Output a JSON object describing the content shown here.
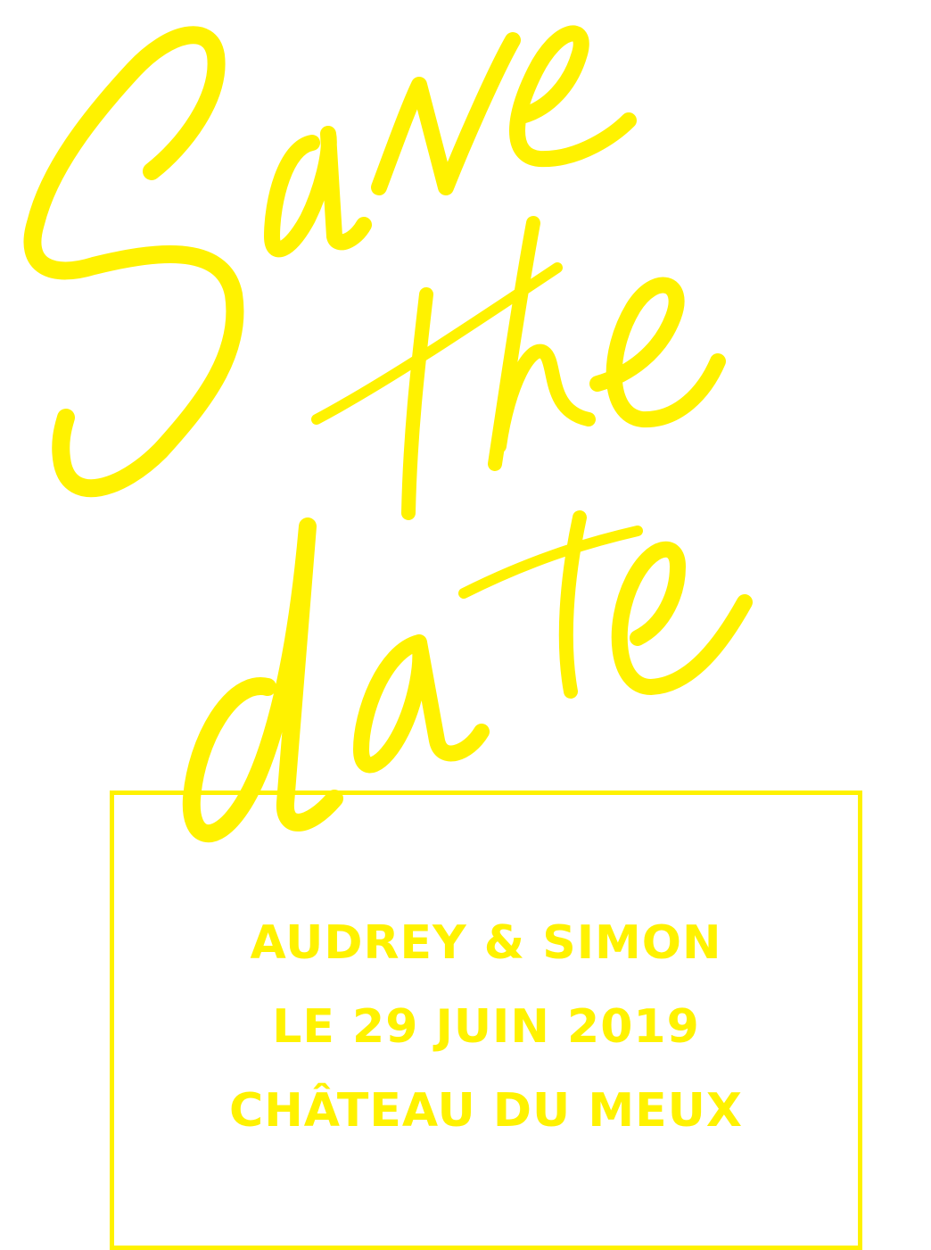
{
  "colors": {
    "accent": "#FFF200",
    "background": "#FFFFFF"
  },
  "artwork": {
    "lettering": "Save the date"
  },
  "details": {
    "names": "AUDREY & SIMON",
    "date": "LE 29 JUIN 2019",
    "venue": "CHÂTEAU DU MEUX"
  }
}
